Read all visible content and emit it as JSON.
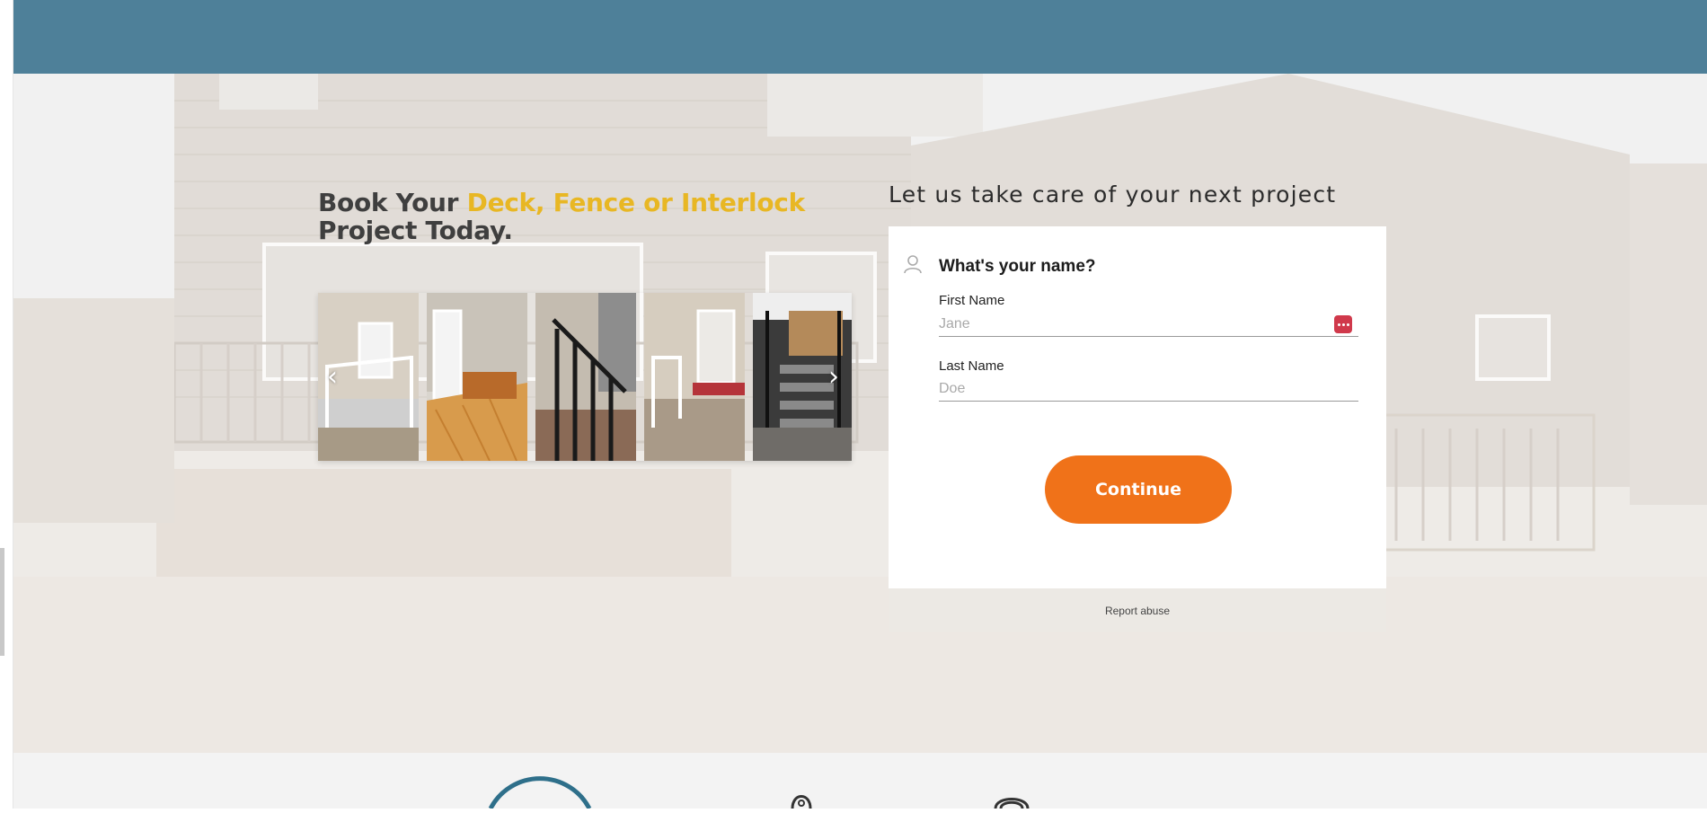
{
  "headline": {
    "prefix": "Book Your ",
    "accent": "Deck, Fence or Interlock",
    "suffix": "Project Today."
  },
  "gallery": {
    "prev_glyph": "‹",
    "next_glyph": "›"
  },
  "form": {
    "heading": "Let us take care of your next project",
    "question": "What's your name?",
    "first_name": {
      "label": "First Name",
      "placeholder": "Jane",
      "value": ""
    },
    "last_name": {
      "label": "Last Name",
      "placeholder": "Doe",
      "value": ""
    },
    "continue_label": "Continue",
    "report_label": "Report abuse"
  },
  "icons": {
    "person": "person-icon",
    "autofill": "password-manager-icon",
    "prev": "chevron-left-icon",
    "next": "chevron-right-icon",
    "lower_pin": "map-pin-icon",
    "lower_wave": "signal-icon"
  },
  "colors": {
    "top_bar": "#4e8099",
    "accent_yellow": "#e8b724",
    "continue_orange": "#f07219",
    "autofill_red": "#d0394b"
  }
}
